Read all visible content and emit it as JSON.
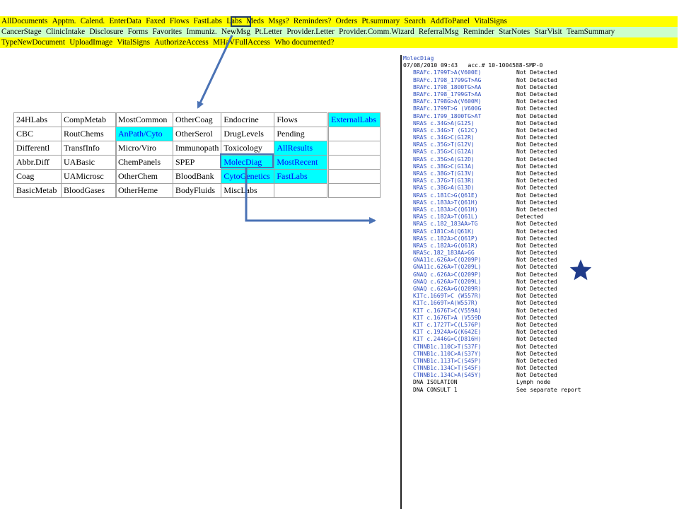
{
  "nav": {
    "row1": [
      "AllDocuments",
      "Apptm.",
      "Calend.",
      "EnterData",
      "Faxed",
      "Flows",
      "FastLabs",
      "Labs",
      "Meds",
      "Msgs?",
      "Reminders?",
      "Orders",
      "Pt.summary",
      "Search",
      "AddToPanel",
      "VitalSigns"
    ],
    "row2": [
      "CancerStage",
      "ClinicIntake",
      "Disclosure",
      "Forms",
      "Favorites",
      "Immuniz.",
      "NewMsg",
      "Pt.Letter",
      "Provider.Letter",
      "Provider.Comm.Wizard",
      "ReferralMsg",
      "Reminder",
      "StarNotes",
      "StarVisit",
      "TeamSummary"
    ],
    "row3": [
      "TypeNewDocument",
      "UploadImage",
      "VitalSigns",
      "AuthorizeAccess",
      "MHaVFullAccess",
      "Who documented?"
    ]
  },
  "labs_menu": {
    "table1": [
      [
        "24HLabs",
        "CompMetab"
      ],
      [
        "CBC",
        "RoutChems"
      ],
      [
        "Differentl",
        "TransfInfo"
      ],
      [
        "Abbr.Diff",
        "UABasic"
      ],
      [
        "Coag",
        "UAMicrosc"
      ],
      [
        "BasicMetab",
        "BloodGases"
      ]
    ],
    "table2": [
      [
        "MostCommon",
        "OtherCoag",
        "Endocrine",
        "Flows"
      ],
      [
        "AnPath/Cyto",
        "OtherSerol",
        "DrugLevels",
        "Pending"
      ],
      [
        "Micro/Viro",
        "Immunopath",
        "Toxicology",
        "AllResults"
      ],
      [
        "ChemPanels",
        "SPEP",
        "MolecDiag",
        "MostRecent"
      ],
      [
        "OtherChem",
        "BloodBank",
        "CytoGenetics",
        "FastLabs"
      ],
      [
        "OtherHeme",
        "BodyFluids",
        "MiscLabs",
        ""
      ]
    ],
    "table3": [
      "ExternalLabs",
      "",
      "",
      "",
      "",
      ""
    ]
  },
  "report": {
    "title": "MolecDiag",
    "header": "07/08/2010 09:43   acc.# 10-1004588-SMP-0",
    "results": [
      [
        "BRAFc.1799T>A(V600E)",
        "Not Detected"
      ],
      [
        "BRAFc.1798_1799GT>AG",
        "Not Detected"
      ],
      [
        "BRAFc.1798_1800TG>AA",
        "Not Detected"
      ],
      [
        "BRAFc.1798_1799GT>AA",
        "Not Detected"
      ],
      [
        "BRAFc.1798G>A(V600M)",
        "Not Detected"
      ],
      [
        "BRAFc.1799T>G (V600G",
        "Not Detected"
      ],
      [
        "BRAFc.1799_1800TG>AT",
        "Not Detected"
      ],
      [
        "NRAS c.34G>A(G12S)",
        "Not Detected"
      ],
      [
        "NRAS c.34G>T (G12C)",
        "Not Detected"
      ],
      [
        "NRAS c.34G>C(G12R)",
        "Not Detected"
      ],
      [
        "NRAS c.35G>T(G12V)",
        "Not Detected"
      ],
      [
        "NRAS c.35G>C(G12A)",
        "Not Detected"
      ],
      [
        "NRAS c.35G>A(G12D)",
        "Not Detected"
      ],
      [
        "NRAS c.38G>C(G13A)",
        "Not Detected"
      ],
      [
        "NRAS c.38G>T(G13V)",
        "Not Detected"
      ],
      [
        "NRAS c.37G>T(G13R)",
        "Not Detected"
      ],
      [
        "NRAS c.38G>A(G13D)",
        "Not Detected"
      ],
      [
        "NRAS c.181C>G(Q61E)",
        "Not Detected"
      ],
      [
        "NRAS c.183A>T(Q61H)",
        "Not Detected"
      ],
      [
        "NRAS c.183A>C(Q61H)",
        "Not Detected"
      ],
      [
        "NRAS c.182A>T(Q61L)",
        "Detected"
      ],
      [
        "NRAS c.182_183AA>TG",
        "Not Detected"
      ],
      [
        "NRAS c181C>A(Q61K)",
        "Not Detected"
      ],
      [
        "NRAS c.182A>C(Q61P)",
        "Not Detected"
      ],
      [
        "NRAS c.182A>G(Q61R)",
        "Not Detected"
      ],
      [
        "NRASc.182_183AA>GG",
        "Not Detected"
      ],
      [
        "GNA11c.626A>C(Q209P)",
        "Not Detected"
      ],
      [
        "GNA11c.626A>T(Q209L)",
        "Not Detected"
      ],
      [
        "GNAQ c.626A>C(Q209P)",
        "Not Detected"
      ],
      [
        "GNAQ c.626A>T(Q209L)",
        "Not Detected"
      ],
      [
        "GNAQ c.626A>G(Q209R)",
        "Not Detected"
      ],
      [
        "KITc.1669T>C (W557R)",
        "Not Detected"
      ],
      [
        "KITc.1669T>A(W557R)",
        "Not Detected"
      ],
      [
        "KIT c.1676T>C(V559A)",
        "Not Detected"
      ],
      [
        "KIT c.1676T>A (V559D",
        "Not Detected"
      ],
      [
        "KIT c.1727T>C(L576P)",
        "Not Detected"
      ],
      [
        "KIT c.1924A>G(K642E)",
        "Not Detected"
      ],
      [
        "KIT c.2446G>C(D816H)",
        "Not Detected"
      ],
      [
        "CTNNB1c.110C>T(S37F)",
        "Not Detected"
      ],
      [
        "CTNNB1c.110C>A(S37Y)",
        "Not Detected"
      ],
      [
        "CTNNB1c.113T>C(S45P)",
        "Not Detected"
      ],
      [
        "CTNNB1c.134C>T(S45F)",
        "Not Detected"
      ],
      [
        "CTNNB1c.134C>A(S45Y)",
        "Not Detected"
      ],
      [
        "DNA ISOLATION",
        "Lymph node"
      ],
      [
        "DNA CONSULT 1",
        "See separate report"
      ]
    ]
  },
  "annotations": {
    "star_icon": "star-icon",
    "arrow_color": "#4a72b5",
    "star_color": "#1f3b8a"
  }
}
